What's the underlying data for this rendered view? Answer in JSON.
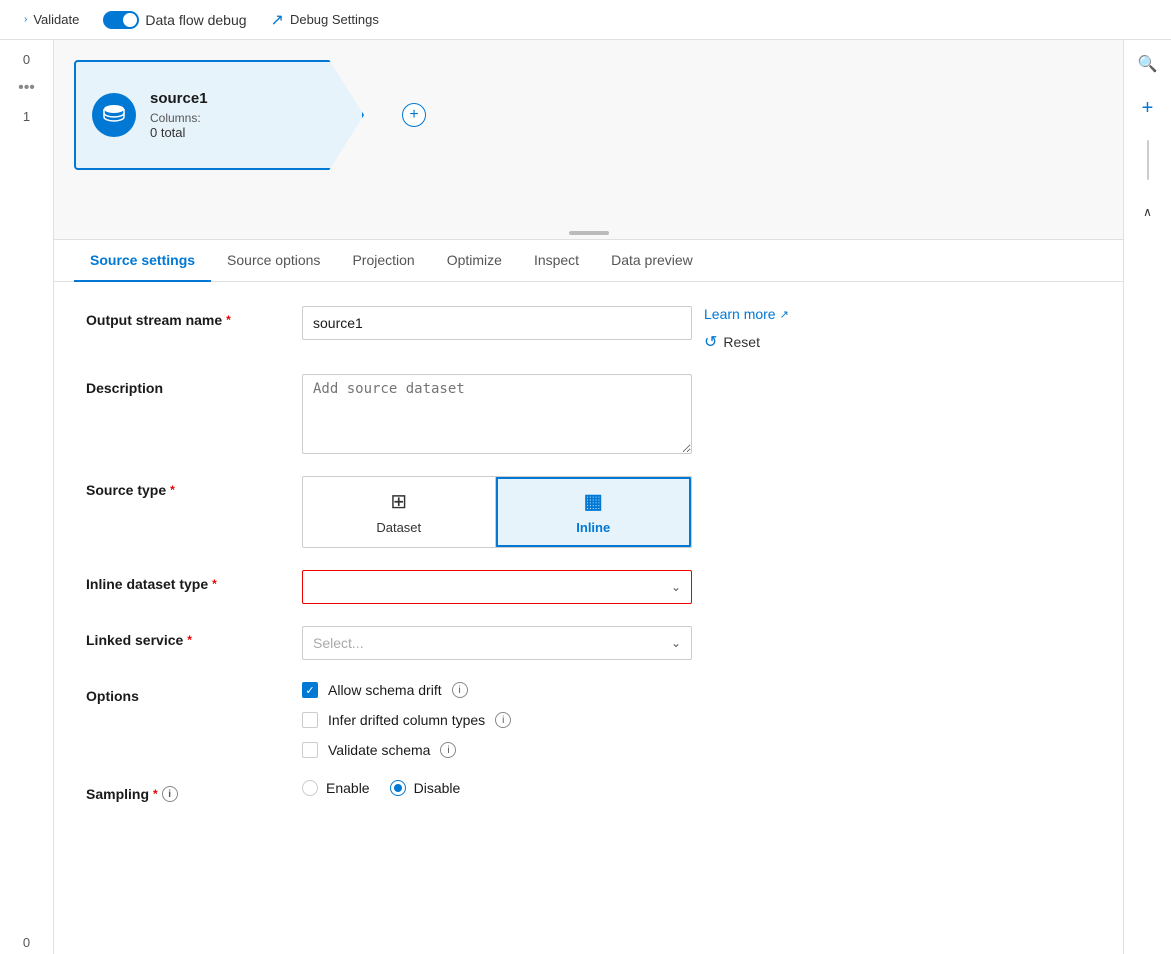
{
  "topbar": {
    "validate_label": "Validate",
    "dataflow_debug_label": "Data flow debug",
    "debug_settings_label": "Debug Settings"
  },
  "sidebar": {
    "numbers": [
      "0",
      "1",
      "0"
    ]
  },
  "node": {
    "title": "source1",
    "columns_label": "Columns:",
    "columns_count": "0 total",
    "plus_symbol": "+"
  },
  "tabs": [
    {
      "id": "source-settings",
      "label": "Source settings",
      "active": true
    },
    {
      "id": "source-options",
      "label": "Source options",
      "active": false
    },
    {
      "id": "projection",
      "label": "Projection",
      "active": false
    },
    {
      "id": "optimize",
      "label": "Optimize",
      "active": false
    },
    {
      "id": "inspect",
      "label": "Inspect",
      "active": false
    },
    {
      "id": "data-preview",
      "label": "Data preview",
      "active": false
    }
  ],
  "form": {
    "output_stream_name": {
      "label": "Output stream name",
      "required": true,
      "value": "source1"
    },
    "description": {
      "label": "Description",
      "required": false,
      "placeholder": "Add source dataset"
    },
    "source_type": {
      "label": "Source type",
      "required": true,
      "options": [
        {
          "id": "dataset",
          "label": "Dataset",
          "active": false,
          "icon": "⊞"
        },
        {
          "id": "inline",
          "label": "Inline",
          "active": true,
          "icon": "▦"
        }
      ]
    },
    "inline_dataset_type": {
      "label": "Inline dataset type",
      "required": true,
      "placeholder": "",
      "value": ""
    },
    "linked_service": {
      "label": "Linked service",
      "required": true,
      "placeholder": "Select..."
    },
    "options": {
      "label": "Options",
      "checkboxes": [
        {
          "id": "allow-schema-drift",
          "label": "Allow schema drift",
          "checked": true,
          "has_info": true
        },
        {
          "id": "infer-drifted-column-types",
          "label": "Infer drifted column types",
          "checked": false,
          "has_info": true
        },
        {
          "id": "validate-schema",
          "label": "Validate schema",
          "checked": false,
          "has_info": true
        }
      ]
    },
    "sampling": {
      "label": "Sampling",
      "required": true,
      "has_info": true,
      "options": [
        {
          "id": "enable",
          "label": "Enable",
          "selected": false
        },
        {
          "id": "disable",
          "label": "Disable",
          "selected": true
        }
      ]
    }
  },
  "actions": {
    "learn_more": "Learn more",
    "reset": "Reset"
  },
  "icons": {
    "search": "🔍",
    "plus": "+",
    "chevron_up": "∧",
    "chevron_down": "⌄",
    "external_link": "↗",
    "reset": "↺",
    "dropdown_arrow": "⌄",
    "dots": "•••"
  }
}
